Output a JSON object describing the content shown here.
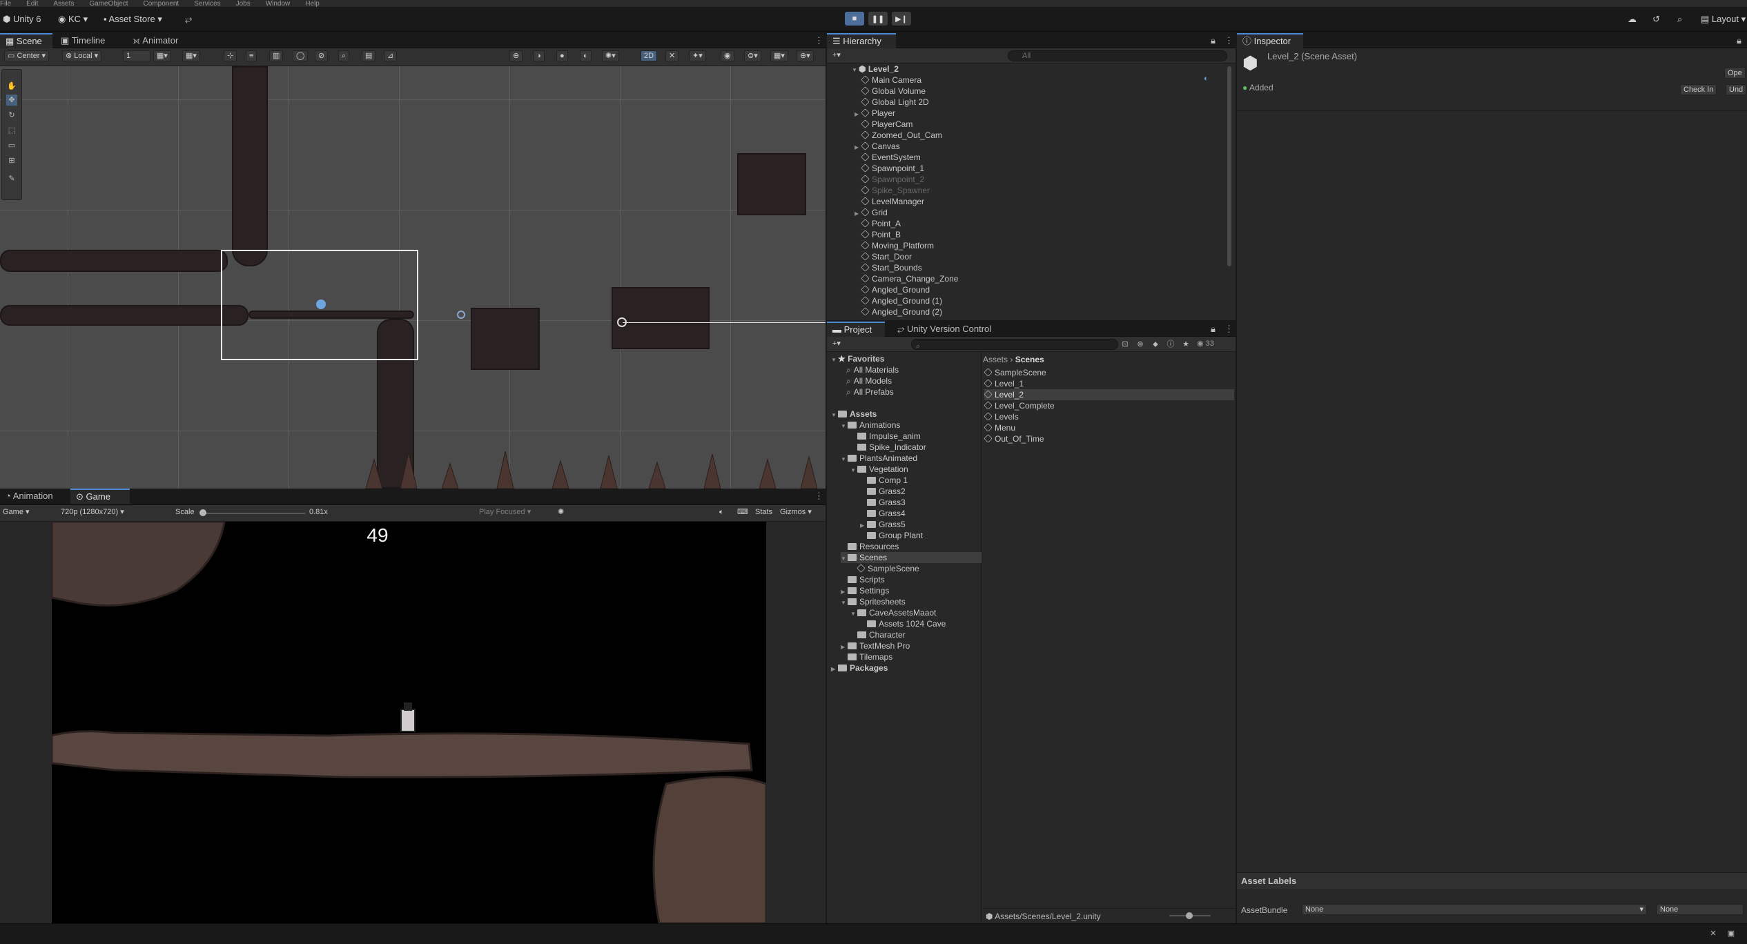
{
  "menu": [
    "File",
    "Edit",
    "Assets",
    "GameObject",
    "Component",
    "Services",
    "Jobs",
    "Window",
    "Help"
  ],
  "toolbar": {
    "app": "Unity 6",
    "account": "KC",
    "asset_store": "Asset Store",
    "layout": "Layout"
  },
  "scene_panel": {
    "tabs": [
      "Scene",
      "Timeline",
      "Animator"
    ],
    "pivot": "Center",
    "space": "Local",
    "snap_value": "1",
    "mode_2d": "2D"
  },
  "game_panel": {
    "tabs": [
      "Animation",
      "Game"
    ],
    "display": "Game",
    "resolution": "720p (1280x720)",
    "scale_label": "Scale",
    "scale_value": "0.81x",
    "play_mode": "Play Focused",
    "stats": "Stats",
    "gizmos": "Gizmos",
    "timer": "49"
  },
  "hierarchy": {
    "title": "Hierarchy",
    "search_placeholder": "All",
    "root": "Level_2",
    "items": [
      {
        "label": "Main Camera",
        "dim": false,
        "expand": false
      },
      {
        "label": "Global Volume",
        "dim": false,
        "expand": false
      },
      {
        "label": "Global Light 2D",
        "dim": false,
        "expand": false
      },
      {
        "label": "Player",
        "dim": false,
        "expand": true
      },
      {
        "label": "PlayerCam",
        "dim": false,
        "expand": false
      },
      {
        "label": "Zoomed_Out_Cam",
        "dim": false,
        "expand": false
      },
      {
        "label": "Canvas",
        "dim": false,
        "expand": true
      },
      {
        "label": "EventSystem",
        "dim": false,
        "expand": false
      },
      {
        "label": "Spawnpoint_1",
        "dim": false,
        "expand": false
      },
      {
        "label": "Spawnpoint_2",
        "dim": true,
        "expand": false
      },
      {
        "label": "Spike_Spawner",
        "dim": true,
        "expand": false
      },
      {
        "label": "LevelManager",
        "dim": false,
        "expand": false
      },
      {
        "label": "Grid",
        "dim": false,
        "expand": true
      },
      {
        "label": "Point_A",
        "dim": false,
        "expand": false
      },
      {
        "label": "Point_B",
        "dim": false,
        "expand": false
      },
      {
        "label": "Moving_Platform",
        "dim": false,
        "expand": false
      },
      {
        "label": "Start_Door",
        "dim": false,
        "expand": false
      },
      {
        "label": "Start_Bounds",
        "dim": false,
        "expand": false
      },
      {
        "label": "Camera_Change_Zone",
        "dim": false,
        "expand": false
      },
      {
        "label": "Angled_Ground",
        "dim": false,
        "expand": false
      },
      {
        "label": "Angled_Ground (1)",
        "dim": false,
        "expand": false
      },
      {
        "label": "Angled_Ground (2)",
        "dim": false,
        "expand": false
      }
    ]
  },
  "project": {
    "tabs": [
      "Project",
      "Unity Version Control"
    ],
    "count": "33",
    "favorites": {
      "title": "Favorites",
      "items": [
        "All Materials",
        "All Models",
        "All Prefabs"
      ]
    },
    "assets_title": "Assets",
    "tree": [
      {
        "label": "Animations",
        "depth": 1,
        "open": true
      },
      {
        "label": "Impulse_anim",
        "depth": 2,
        "open": null
      },
      {
        "label": "Spike_Indicator",
        "depth": 2,
        "open": null
      },
      {
        "label": "PlantsAnimated",
        "depth": 1,
        "open": true
      },
      {
        "label": "Vegetation",
        "depth": 2,
        "open": true
      },
      {
        "label": "Comp 1",
        "depth": 3,
        "open": null
      },
      {
        "label": "Grass2",
        "depth": 3,
        "open": null
      },
      {
        "label": "Grass3",
        "depth": 3,
        "open": null
      },
      {
        "label": "Grass4",
        "depth": 3,
        "open": null
      },
      {
        "label": "Grass5",
        "depth": 3,
        "open": false
      },
      {
        "label": "Group Plant",
        "depth": 3,
        "open": null
      },
      {
        "label": "Resources",
        "depth": 1,
        "open": null
      },
      {
        "label": "Scenes",
        "depth": 1,
        "open": true,
        "sel": true
      },
      {
        "label": "SampleScene",
        "depth": 2,
        "open": null,
        "scene": true
      },
      {
        "label": "Scripts",
        "depth": 1,
        "open": null
      },
      {
        "label": "Settings",
        "depth": 1,
        "open": false
      },
      {
        "label": "Spritesheets",
        "depth": 1,
        "open": true
      },
      {
        "label": "CaveAssetsMaaot",
        "depth": 2,
        "open": true
      },
      {
        "label": "Assets 1024 Cave",
        "depth": 3,
        "open": null
      },
      {
        "label": "Character",
        "depth": 2,
        "open": null
      },
      {
        "label": "TextMesh Pro",
        "depth": 1,
        "open": false
      },
      {
        "label": "Tilemaps",
        "depth": 1,
        "open": null
      }
    ],
    "packages": "Packages",
    "breadcrumb": [
      "Assets",
      "Scenes"
    ],
    "files": [
      "SampleScene",
      "Level_1",
      "Level_2",
      "Level_Complete",
      "Levels",
      "Menu",
      "Out_Of_Time"
    ],
    "selected_file": "Level_2",
    "footer_path": "Assets/Scenes/Level_2.unity"
  },
  "inspector": {
    "title": "Inspector",
    "asset_title": "Level_2 (Scene Asset)",
    "open_btn": "Ope",
    "status": "Added",
    "checkin": "Check In",
    "undo": "Und",
    "labels_title": "Asset Labels",
    "bundle_label": "AssetBundle",
    "bundle_value": "None",
    "variant_value": "None"
  },
  "colors": {
    "accent": "#4f8ad8",
    "selection": "#3e3e3e",
    "scene_bg": "#4b4b4b"
  }
}
